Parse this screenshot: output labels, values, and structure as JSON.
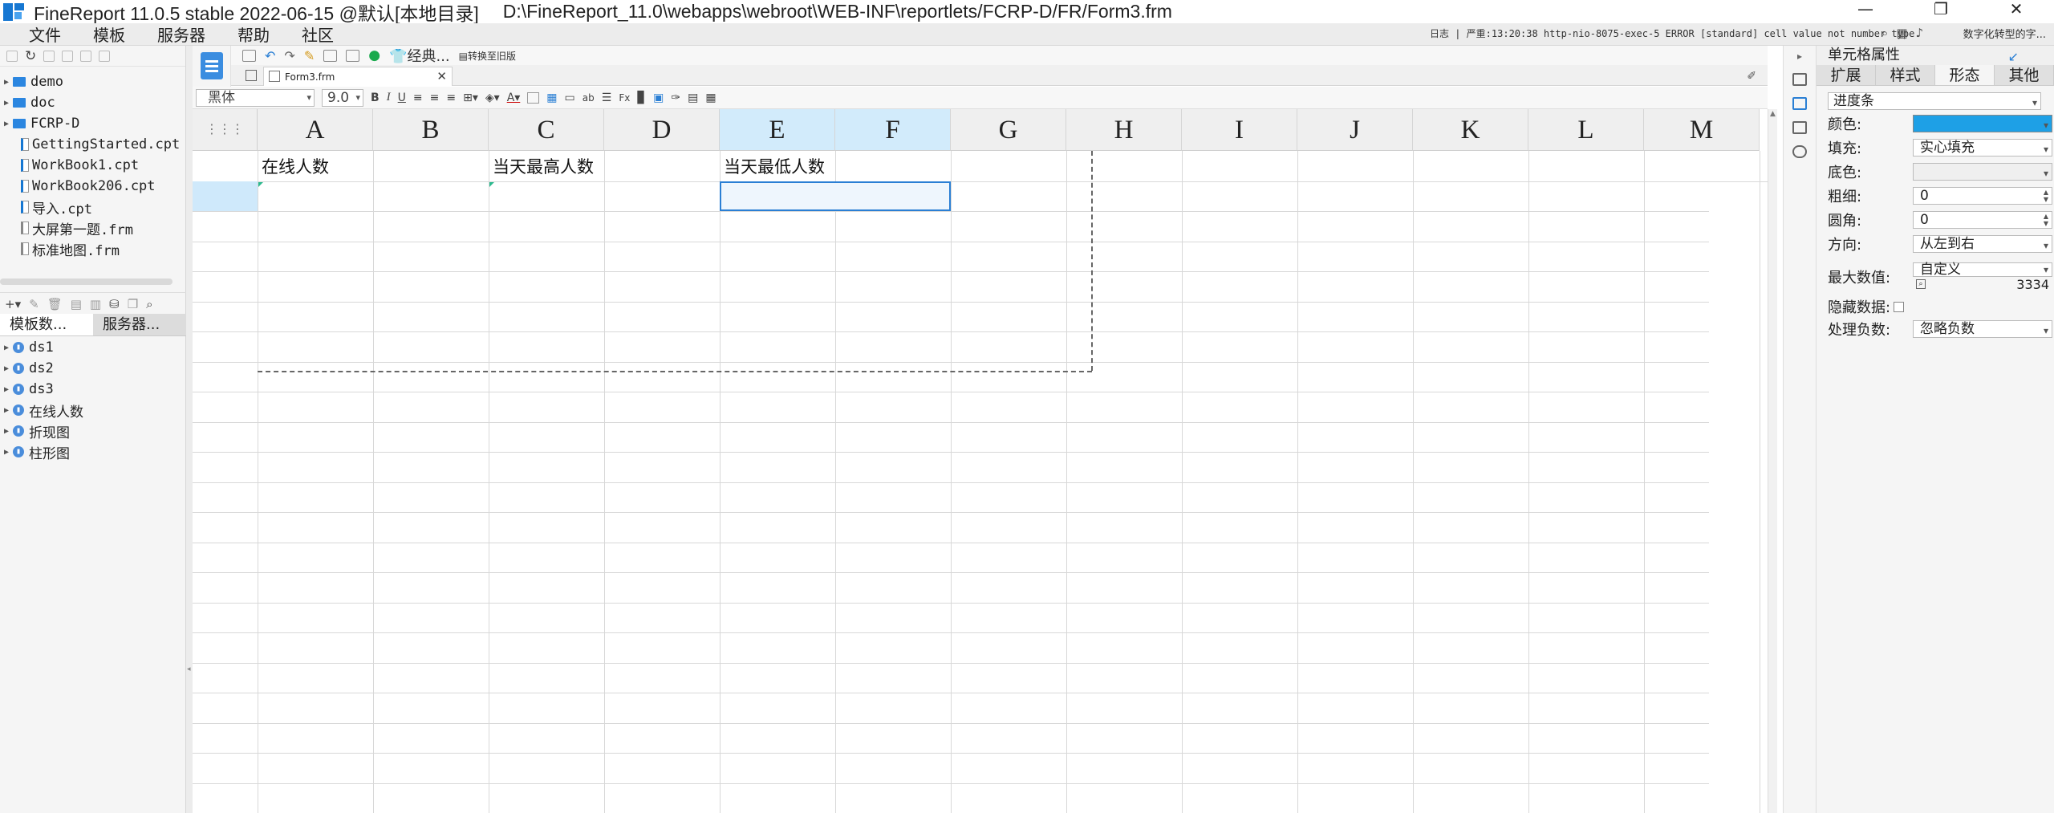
{
  "window": {
    "title": "FineReport 11.0.5 stable 2022-06-15 @默认[本地目录]",
    "path": "D:\\FineReport_11.0\\webapps\\webroot\\WEB-INF\\reportlets/FCRP-D/FR/Form3.frm",
    "minimize": "—",
    "restore": "❐",
    "close": "✕"
  },
  "menu": {
    "items": [
      "文件",
      "模板",
      "服务器",
      "帮助",
      "社区"
    ]
  },
  "log": {
    "text": "日志 | 严重:13:20:38 http-nio-8075-exec-5 ERROR [standard] cell value not number type.",
    "badge": "数字化转型的字..."
  },
  "file_tree": {
    "items": [
      {
        "label": "demo",
        "type": "folder"
      },
      {
        "label": "doc",
        "type": "folder"
      },
      {
        "label": "FCRP-D",
        "type": "folder"
      },
      {
        "label": "GettingStarted.cpt",
        "type": "cpt"
      },
      {
        "label": "WorkBook1.cpt",
        "type": "cpt"
      },
      {
        "label": "WorkBook206.cpt",
        "type": "cpt"
      },
      {
        "label": "导入.cpt",
        "type": "cpt"
      },
      {
        "label": "大屏第一题.frm",
        "type": "frm"
      },
      {
        "label": "标准地图.frm",
        "type": "frm"
      }
    ]
  },
  "data_panel": {
    "tabs": [
      "模板数...",
      "服务器..."
    ],
    "datasets": [
      "ds1",
      "ds2",
      "ds3",
      "在线人数",
      "折现图",
      "柱形图"
    ]
  },
  "toolbar": {
    "classic_label": "经典...",
    "switch_label": "转换至旧版"
  },
  "doc_tab": {
    "label": "Form3.frm",
    "close": "✕"
  },
  "format": {
    "font": "黑体",
    "size": "9.0"
  },
  "sheet": {
    "columns": [
      "A",
      "B",
      "C",
      "D",
      "E",
      "F",
      "G",
      "H",
      "I",
      "J",
      "K",
      "L",
      "M"
    ],
    "selected_columns": [
      "E",
      "F"
    ],
    "cells": {
      "A1": "在线人数",
      "C1": "当天最高人数",
      "E1": "当天最低人数"
    }
  },
  "properties": {
    "title": "单元格属性",
    "tabs": [
      "扩展",
      "样式",
      "形态",
      "其他"
    ],
    "active_tab": "形态",
    "shape_type": "进度条",
    "rows": [
      {
        "label": "颜色:",
        "value": ""
      },
      {
        "label": "填充:",
        "value": "实心填充"
      },
      {
        "label": "底色:",
        "value": ""
      },
      {
        "label": "粗细:",
        "value": "0"
      },
      {
        "label": "圆角:",
        "value": "0"
      },
      {
        "label": "方向:",
        "value": "从左到右"
      }
    ],
    "max_label": "最大数值:",
    "max_mode": "自定义",
    "max_value": "3334",
    "hide_label": "隐藏数据:",
    "negative_label": "处理负数:",
    "negative_value": "忽略负数",
    "colors": {
      "fill": "#1ea0e6"
    }
  }
}
